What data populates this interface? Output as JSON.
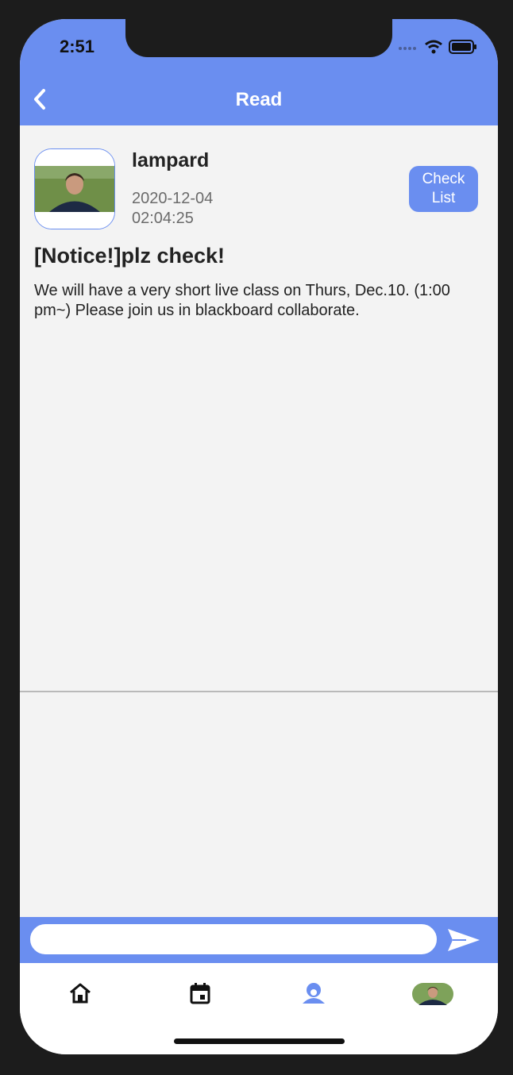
{
  "status_bar": {
    "time": "2:51"
  },
  "header": {
    "title": "Read"
  },
  "post": {
    "author": "lampard",
    "date": "2020-12-04",
    "time": "02:04:25",
    "check_list_label": "Check List",
    "title": "[Notice!]plz check!",
    "body": "We will have a very short live class on Thurs, Dec.10. (1:00 pm~) Please join us in blackboard collaborate."
  },
  "composer": {
    "value": "",
    "placeholder": ""
  },
  "colors": {
    "accent": "#6a8ef0",
    "background": "#f3f3f3"
  },
  "icons": {
    "back": "chevron-left-icon",
    "send": "send-icon",
    "tabs": [
      "home-icon",
      "calendar-icon",
      "user-icon",
      "profile-avatar"
    ]
  }
}
